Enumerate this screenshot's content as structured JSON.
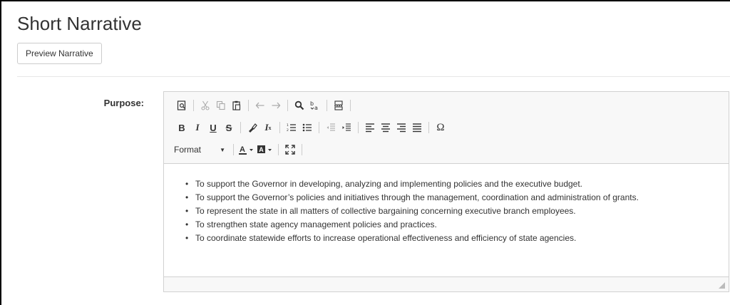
{
  "header": {
    "title": "Short Narrative",
    "preview_label": "Preview Narrative"
  },
  "field": {
    "label": "Purpose:"
  },
  "toolbar": {
    "format_label": "Format",
    "row1": [
      "preview-icon",
      "cut-icon",
      "copy-icon",
      "paste-icon",
      "undo-icon",
      "redo-icon",
      "find-icon",
      "replace-icon",
      "page-break-icon"
    ],
    "row2": [
      "bold-icon",
      "italic-icon",
      "underline-icon",
      "strikethrough-icon",
      "copy-format-icon",
      "remove-format-icon",
      "numbered-list-icon",
      "bulleted-list-icon",
      "decrease-indent-icon",
      "increase-indent-icon",
      "align-left-icon",
      "align-center-icon",
      "align-right-icon",
      "justify-icon",
      "special-character-icon"
    ],
    "row3": [
      "format-dropdown",
      "text-color-icon",
      "background-color-icon",
      "maximize-icon"
    ]
  },
  "content": {
    "items": [
      "To support the Governor in developing, analyzing and implementing policies and the executive budget.",
      "To support the Governor’s policies and initiatives through the management, coordination and administration of grants.",
      "To represent the state in all matters of collective bargaining concerning executive branch employees.",
      "To strengthen state agency management policies and practices.",
      "To coordinate statewide efforts to increase operational effectiveness and efficiency of state agencies."
    ]
  },
  "colors": {
    "toolbar_bg": "#f8f8f8",
    "border": "#d1d1d1",
    "text": "#333333",
    "disabled_icon": "#aaaaaa"
  }
}
